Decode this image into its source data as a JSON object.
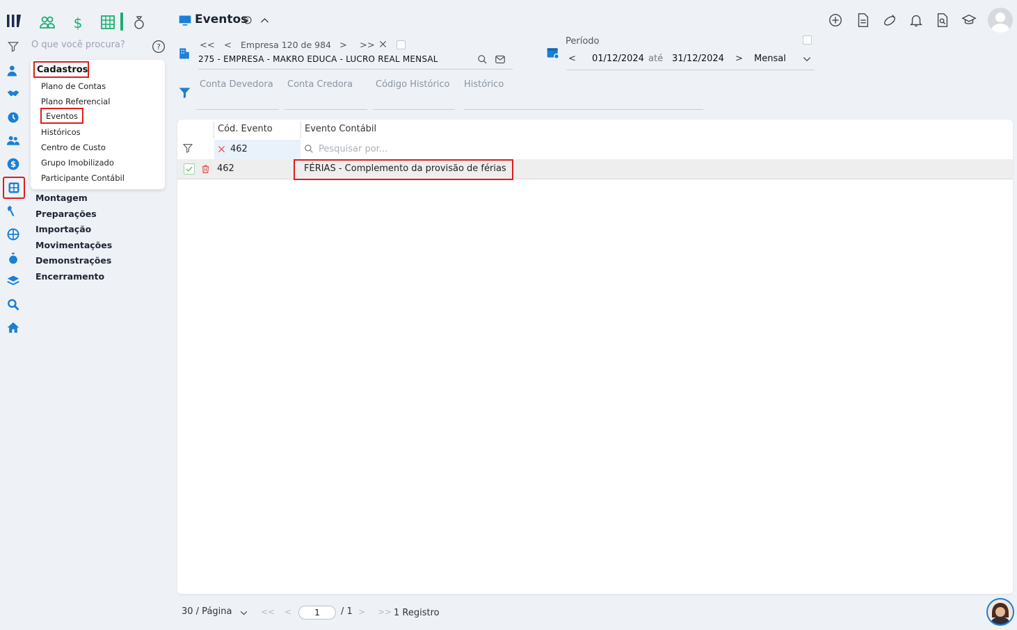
{
  "search": {
    "placeholder": "O que você procura?"
  },
  "sidebar": {
    "section_title": "Cadastros",
    "items": [
      {
        "label": "Plano de Contas"
      },
      {
        "label": "Plano Referencial"
      },
      {
        "label": "Eventos"
      },
      {
        "label": "Históricos"
      },
      {
        "label": "Centro de Custo"
      },
      {
        "label": "Grupo Imobilizado"
      },
      {
        "label": "Participante Contábil"
      }
    ],
    "groups": [
      {
        "label": "Montagem"
      },
      {
        "label": "Preparações"
      },
      {
        "label": "Importação"
      },
      {
        "label": "Movimentações"
      },
      {
        "label": "Demonstrações"
      },
      {
        "label": "Encerramento"
      }
    ]
  },
  "header": {
    "title": "Eventos",
    "company_nav": "Empresa 120 de 984",
    "company": "275 - EMPRESA - MAKRO EDUCA - LUCRO REAL MENSAL",
    "period_label": "Período",
    "date_start": "01/12/2024",
    "date_sep": "até",
    "date_end": "31/12/2024",
    "period_type": "Mensal"
  },
  "filters": {
    "conta_devedora": "Conta Devedora",
    "conta_credora": "Conta Credora",
    "codigo_historico": "Código Histórico",
    "historico": "Histórico"
  },
  "table": {
    "columns": [
      "Cód. Evento",
      "Evento Contábil"
    ],
    "filter_code": "462",
    "filter_search_placeholder": "Pesquisar por...",
    "rows": [
      {
        "code": "462",
        "event": "FÉRIAS - Complemento da provisão de férias"
      }
    ]
  },
  "pager": {
    "per_page": "30 / Página",
    "page": "1",
    "total_pages": "/ 1",
    "records": "1 Registro"
  },
  "colors": {
    "accent": "#1a7fd6",
    "highlight": "#e01b1b",
    "green": "#1aae6f"
  }
}
